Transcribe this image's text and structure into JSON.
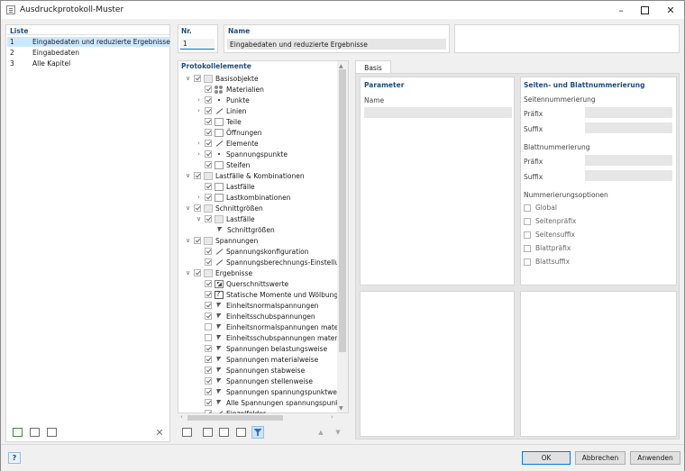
{
  "window": {
    "title": "Ausdruckprotokoll-Muster"
  },
  "colors": {
    "selection": "#cce8ff",
    "heading": "#1e4e79",
    "accent": "#0078d7"
  },
  "list": {
    "header": "Liste",
    "items": [
      {
        "num": "1",
        "label": "Eingabedaten und reduzierte Ergebnisse",
        "selected": true
      },
      {
        "num": "2",
        "label": "Eingabedaten",
        "selected": false
      },
      {
        "num": "3",
        "label": "Alle Kapitel",
        "selected": false
      }
    ]
  },
  "fields": {
    "nr_label": "Nr.",
    "nr_value": "1",
    "name_label": "Name",
    "name_value": "Eingabedaten und reduzierte Ergebnisse"
  },
  "tree": {
    "header": "Protokollelemente",
    "rows": [
      {
        "label": "Basisobjekte",
        "level": 0,
        "chevron": "down",
        "icon": "folder",
        "checked": true,
        "dim": false
      },
      {
        "label": "Materialien",
        "level": 1,
        "chevron": "",
        "icon": "mat",
        "checked": true,
        "dim": false
      },
      {
        "label": "Punkte",
        "level": 1,
        "chevron": "right",
        "icon": "dot",
        "checked": true,
        "dim": false
      },
      {
        "label": "Linien",
        "level": 1,
        "chevron": "right",
        "icon": "line",
        "checked": true,
        "dim": false
      },
      {
        "label": "Teile",
        "level": 1,
        "chevron": "",
        "icon": "doc",
        "checked": true,
        "dim": false
      },
      {
        "label": "Öffnungen",
        "level": 1,
        "chevron": "",
        "icon": "doc",
        "checked": true,
        "dim": false
      },
      {
        "label": "Elemente",
        "level": 1,
        "chevron": "right",
        "icon": "line",
        "checked": true,
        "dim": false
      },
      {
        "label": "Spannungspunkte",
        "level": 1,
        "chevron": "right",
        "icon": "dot",
        "checked": true,
        "dim": false
      },
      {
        "label": "Steifen",
        "level": 1,
        "chevron": "",
        "icon": "doc",
        "checked": true,
        "dim": false
      },
      {
        "label": "Lastfälle & Kombinationen",
        "level": 0,
        "chevron": "down",
        "icon": "folder",
        "checked": true,
        "dim": false
      },
      {
        "label": "Lastfälle",
        "level": 1,
        "chevron": "",
        "icon": "doc",
        "checked": true,
        "dim": false
      },
      {
        "label": "Lastkombinationen",
        "level": 1,
        "chevron": "right",
        "icon": "doc",
        "checked": true,
        "dim": false
      },
      {
        "label": "Schnittgrößen",
        "level": 0,
        "chevron": "down",
        "icon": "folder",
        "checked": true,
        "dim": false
      },
      {
        "label": "Lastfälle",
        "level": 1,
        "chevron": "down",
        "icon": "folder",
        "checked": true,
        "dim": false
      },
      {
        "label": "Schnittgrößen",
        "level": 2,
        "chevron": "",
        "icon": "pin",
        "checked": false,
        "dim": false,
        "nocb": true
      },
      {
        "label": "Spannungen",
        "level": 0,
        "chevron": "down",
        "icon": "folder",
        "checked": true,
        "dim": false
      },
      {
        "label": "Spannungskonfiguration",
        "level": 1,
        "chevron": "",
        "icon": "line",
        "checked": true,
        "dim": false
      },
      {
        "label": "Spannungsberechnungs-Einstellung",
        "level": 1,
        "chevron": "",
        "icon": "line",
        "checked": true,
        "dim": false
      },
      {
        "label": "Ergebnisse",
        "level": 0,
        "chevron": "down",
        "icon": "folder",
        "checked": true,
        "dim": false
      },
      {
        "label": "Querschnittswerte",
        "level": 1,
        "chevron": "",
        "icon": "res",
        "checked": true,
        "dim": false
      },
      {
        "label": "Statische Momente und Wölbung",
        "level": 1,
        "chevron": "",
        "icon": "q",
        "checked": true,
        "dim": false
      },
      {
        "label": "Einheitsnormalspannungen",
        "level": 1,
        "chevron": "",
        "icon": "pin",
        "checked": true,
        "dim": false
      },
      {
        "label": "Einheitsschubspannungen",
        "level": 1,
        "chevron": "",
        "icon": "pin",
        "checked": true,
        "dim": false
      },
      {
        "label": "Einheitsnormalspannungen materialw",
        "level": 1,
        "chevron": "",
        "icon": "pin",
        "checked": false,
        "dim": false
      },
      {
        "label": "Einheitsschubspannungen materialwe",
        "level": 1,
        "chevron": "",
        "icon": "pin",
        "checked": false,
        "dim": false
      },
      {
        "label": "Spannungen belastungsweise",
        "level": 1,
        "chevron": "",
        "icon": "pin",
        "checked": true,
        "dim": false
      },
      {
        "label": "Spannungen materialweise",
        "level": 1,
        "chevron": "",
        "icon": "pin",
        "checked": true,
        "dim": false
      },
      {
        "label": "Spannungen stabweise",
        "level": 1,
        "chevron": "",
        "icon": "pin",
        "checked": true,
        "dim": false
      },
      {
        "label": "Spannungen stellenweise",
        "level": 1,
        "chevron": "",
        "icon": "pin",
        "checked": true,
        "dim": false
      },
      {
        "label": "Spannungen spannungspunktweise",
        "level": 1,
        "chevron": "",
        "icon": "pin",
        "checked": true,
        "dim": false
      },
      {
        "label": "Alle Spannungen spannungspunktwe",
        "level": 1,
        "chevron": "",
        "icon": "pin",
        "checked": true,
        "dim": false
      },
      {
        "label": "Einzelfelder",
        "level": 1,
        "chevron": "",
        "icon": "line",
        "checked": true,
        "dim": false
      }
    ]
  },
  "tabs": {
    "basis": "Basis"
  },
  "parameter": {
    "header": "Parameter",
    "name_label": "Name"
  },
  "numbering": {
    "header": "Seiten- und Blattnummerierung",
    "page_numbering": "Seitennummerierung",
    "prefix": "Präfix",
    "suffix": "Suffix",
    "sheet_numbering": "Blattnummerierung",
    "options_header": "Nummerierungsoptionen",
    "options": [
      {
        "label": "Global",
        "checked": false
      },
      {
        "label": "Seitenpräfix",
        "checked": false
      },
      {
        "label": "Seitensuffix",
        "checked": false
      },
      {
        "label": "Blattpräfix",
        "checked": false
      },
      {
        "label": "Blattsuffix",
        "checked": false
      }
    ]
  },
  "buttons": {
    "ok": "OK",
    "cancel": "Abbrechen",
    "apply": "Anwenden"
  }
}
